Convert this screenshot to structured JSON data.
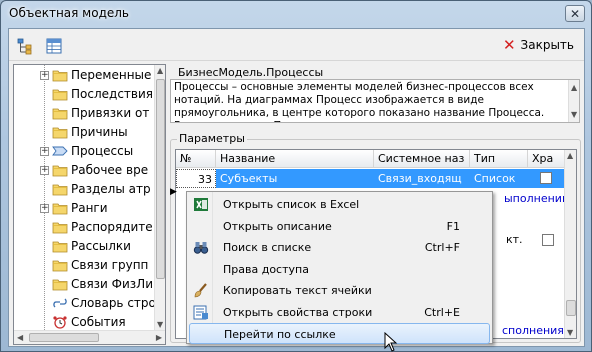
{
  "window": {
    "title": "Объектная модель",
    "close_glyph": "✕"
  },
  "toolbar": {
    "close_label": "Закрыть"
  },
  "tree": {
    "items": [
      {
        "label": "Переменные",
        "expandable": true,
        "icon": "folder-icon"
      },
      {
        "label": "Последствия",
        "expandable": false,
        "icon": "folder-icon"
      },
      {
        "label": "Привязки от",
        "expandable": false,
        "icon": "folder-icon"
      },
      {
        "label": "Причины",
        "expandable": false,
        "icon": "folder-icon"
      },
      {
        "label": "Процессы",
        "expandable": true,
        "icon": "process-arrow-icon"
      },
      {
        "label": "Рабочее вре",
        "expandable": true,
        "icon": "folder-icon"
      },
      {
        "label": "Разделы атр",
        "expandable": false,
        "icon": "folder-icon"
      },
      {
        "label": "Ранги",
        "expandable": true,
        "icon": "folder-icon"
      },
      {
        "label": "Распорядите",
        "expandable": false,
        "icon": "folder-icon"
      },
      {
        "label": "Рассылки",
        "expandable": false,
        "icon": "folder-icon"
      },
      {
        "label": "Связи групп",
        "expandable": false,
        "icon": "folder-icon"
      },
      {
        "label": "Связи ФизЛи",
        "expandable": false,
        "icon": "folder-icon"
      },
      {
        "label": "Словарь стро",
        "expandable": false,
        "icon": "link-icon"
      },
      {
        "label": "События",
        "expandable": false,
        "icon": "alarm-clock-icon"
      }
    ]
  },
  "description": {
    "group_title": "БизнесМодель.Процессы",
    "text": "Процессы – основные элементы моделей бизнес-процессов всех нотаций. На диаграммах Процесс изображается в виде прямоугольника, в центре которого показано название Процесса. Возможные типы Процессов:"
  },
  "params": {
    "group_title": "Параметры",
    "columns": [
      "№",
      "Название",
      "Системное наз",
      "Тип",
      "Хра"
    ],
    "selected_row": {
      "num": "33",
      "name": "Субъекты",
      "sysname": "Связи_входящ",
      "type": "Список",
      "stored": false
    },
    "peek_right_1": "ыполнении",
    "peek_right_2": "кт.",
    "peek_right_3": "сполнения),"
  },
  "context_menu": {
    "items": [
      {
        "label": "Открыть список в Excel",
        "shortcut": "",
        "icon": "excel-icon"
      },
      {
        "label": "Открыть описание",
        "shortcut": "F1",
        "icon": ""
      },
      {
        "label": "Поиск в списке",
        "shortcut": "Ctrl+F",
        "icon": "binoculars-icon"
      },
      {
        "label": "Права доступа",
        "shortcut": "",
        "icon": ""
      },
      {
        "label": "Копировать текст ячейки",
        "shortcut": "",
        "icon": "brush-icon"
      },
      {
        "label": "Открыть свойства строки",
        "shortcut": "Ctrl+E",
        "icon": "properties-icon"
      },
      {
        "label": "Перейти по ссылке",
        "shortcut": "",
        "icon": ""
      }
    ],
    "highlighted_index": 6
  },
  "colors": {
    "selection": "#3399ff",
    "link": "#0000cc"
  }
}
